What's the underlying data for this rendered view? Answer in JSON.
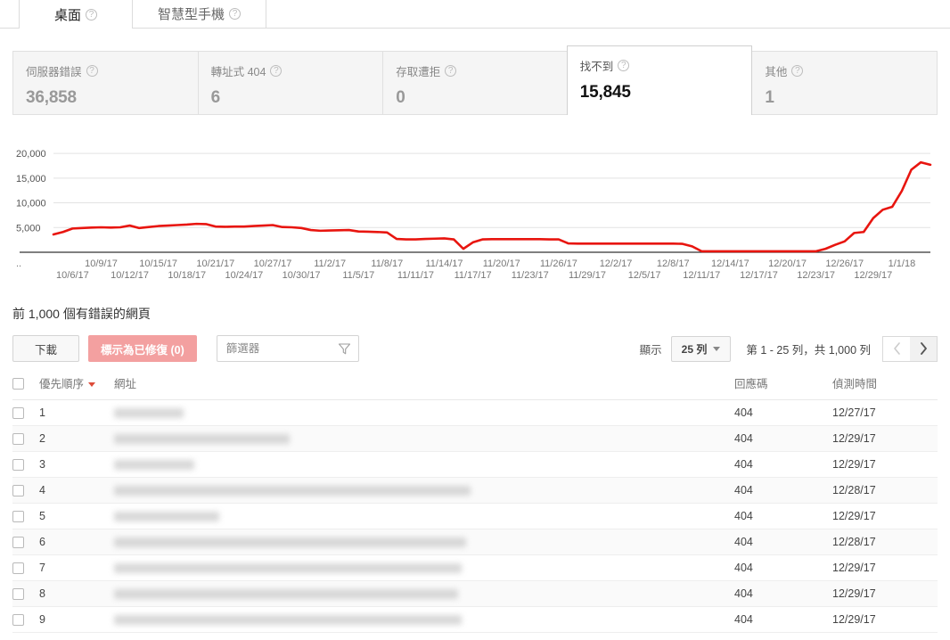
{
  "tabs": [
    {
      "label": "桌面",
      "help": "?",
      "active": true
    },
    {
      "label": "智慧型手機",
      "help": "?",
      "active": false
    }
  ],
  "cards": [
    {
      "label": "伺服器錯誤",
      "value": "36,858",
      "selected": false
    },
    {
      "label": "轉址式 404",
      "value": "6",
      "selected": false
    },
    {
      "label": "存取遭拒",
      "value": "0",
      "selected": false
    },
    {
      "label": "找不到",
      "value": "15,845",
      "selected": true
    },
    {
      "label": "其他",
      "value": "1",
      "selected": false
    }
  ],
  "chart_data": {
    "type": "line",
    "title": "",
    "xlabel": "",
    "ylabel": "",
    "ylim": [
      0,
      22000
    ],
    "yticks": [
      5000,
      10000,
      15000,
      20000
    ],
    "ytick_labels": [
      "5,000",
      "10,000",
      "15,000",
      "20,000"
    ],
    "grid": true,
    "legend": "none",
    "line_color": "#e8150f",
    "axis_prefix": "..",
    "xtick_labels_top": [
      "10/9/17",
      "10/15/17",
      "10/21/17",
      "10/27/17",
      "11/2/17",
      "11/8/17",
      "11/14/17",
      "11/20/17",
      "11/26/17",
      "12/2/17",
      "12/8/17",
      "12/14/17",
      "12/20/17",
      "12/26/17",
      "1/1/18"
    ],
    "xtick_labels_bottom": [
      "10/6/17",
      "10/12/17",
      "10/18/17",
      "10/24/17",
      "10/30/17",
      "11/5/17",
      "11/11/17",
      "11/17/17",
      "11/23/17",
      "11/29/17",
      "12/5/17",
      "12/11/17",
      "12/17/17",
      "12/23/17",
      "12/29/17"
    ],
    "x": [
      "10/4/17",
      "10/5/17",
      "10/6/17",
      "10/7/17",
      "10/8/17",
      "10/9/17",
      "10/10/17",
      "10/11/17",
      "10/12/17",
      "10/13/17",
      "10/14/17",
      "10/15/17",
      "10/16/17",
      "10/17/17",
      "10/18/17",
      "10/19/17",
      "10/20/17",
      "10/21/17",
      "10/22/17",
      "10/23/17",
      "10/24/17",
      "10/25/17",
      "10/26/17",
      "10/27/17",
      "10/28/17",
      "10/29/17",
      "10/30/17",
      "10/31/17",
      "11/1/17",
      "11/2/17",
      "11/3/17",
      "11/4/17",
      "11/5/17",
      "11/6/17",
      "11/7/17",
      "11/8/17",
      "11/9/17",
      "11/10/17",
      "11/11/17",
      "11/12/17",
      "11/13/17",
      "11/14/17",
      "11/15/17",
      "11/16/17",
      "11/17/17",
      "11/18/17",
      "11/19/17",
      "11/20/17",
      "11/21/17",
      "11/22/17",
      "11/23/17",
      "11/24/17",
      "11/25/17",
      "11/26/17",
      "11/27/17",
      "11/28/17",
      "11/29/17",
      "11/30/17",
      "12/1/17",
      "12/2/17",
      "12/3/17",
      "12/4/17",
      "12/5/17",
      "12/6/17",
      "12/7/17",
      "12/8/17",
      "12/9/17",
      "12/10/17",
      "12/11/17",
      "12/12/17",
      "12/13/17",
      "12/14/17",
      "12/15/17",
      "12/16/17",
      "12/17/17",
      "12/18/17",
      "12/19/17",
      "12/20/17",
      "12/21/17",
      "12/22/17",
      "12/23/17",
      "12/24/17",
      "12/25/17",
      "12/26/17",
      "12/27/17",
      "12/28/17",
      "12/29/17",
      "12/30/17",
      "12/31/17",
      "1/1/18",
      "1/2/18"
    ],
    "values": [
      3600,
      4100,
      4800,
      4900,
      5000,
      5050,
      5000,
      5050,
      5400,
      4900,
      5100,
      5300,
      5400,
      5500,
      5600,
      5750,
      5700,
      5200,
      5150,
      5200,
      5200,
      5300,
      5400,
      5500,
      5100,
      5050,
      4900,
      4500,
      4350,
      4400,
      4450,
      4500,
      4200,
      4150,
      4100,
      4000,
      2700,
      2600,
      2600,
      2700,
      2750,
      2800,
      2600,
      700,
      2000,
      2600,
      2650,
      2650,
      2650,
      2650,
      2650,
      2650,
      2600,
      2600,
      1800,
      1750,
      1750,
      1750,
      1750,
      1750,
      1750,
      1750,
      1750,
      1750,
      1750,
      1750,
      1700,
      1200,
      200,
      200,
      200,
      200,
      200,
      200,
      200,
      200,
      200,
      200,
      200,
      200,
      200,
      700,
      1500,
      2200,
      3900,
      4100,
      6900,
      8600,
      9200,
      12400,
      16700,
      18200,
      17700
    ]
  },
  "section": {
    "title": "前 1,000 個有錯誤的網頁"
  },
  "toolbar": {
    "download_label": "下載",
    "mark_fixed_label": "標示為已修復 (0)",
    "filter_placeholder": "篩選器",
    "filter_value": "",
    "show_label": "顯示",
    "rows_per_page": "25 列",
    "range_text": "第 1 - 25 列，共 1,000 列"
  },
  "table": {
    "columns": [
      "優先順序",
      "網址",
      "回應碼",
      "偵測時間"
    ],
    "sorted_column": "優先順序",
    "rows": [
      {
        "priority": "1",
        "url_width": 78,
        "code": "404",
        "time": "12/27/17"
      },
      {
        "priority": "2",
        "url_width": 197,
        "code": "404",
        "time": "12/29/17"
      },
      {
        "priority": "3",
        "url_width": 90,
        "code": "404",
        "time": "12/29/17"
      },
      {
        "priority": "4",
        "url_width": 400,
        "code": "404",
        "time": "12/28/17"
      },
      {
        "priority": "5",
        "url_width": 118,
        "code": "404",
        "time": "12/29/17"
      },
      {
        "priority": "6",
        "url_width": 395,
        "code": "404",
        "time": "12/28/17"
      },
      {
        "priority": "7",
        "url_width": 390,
        "code": "404",
        "time": "12/29/17"
      },
      {
        "priority": "8",
        "url_width": 386,
        "code": "404",
        "time": "12/29/17"
      },
      {
        "priority": "9",
        "url_width": 390,
        "code": "404",
        "time": "12/29/17"
      }
    ]
  },
  "colors": {
    "accent_red": "#dd4b39",
    "line_red": "#e8150f",
    "fixed_button": "#f3a0a0",
    "card_bg": "#f5f5f5"
  }
}
